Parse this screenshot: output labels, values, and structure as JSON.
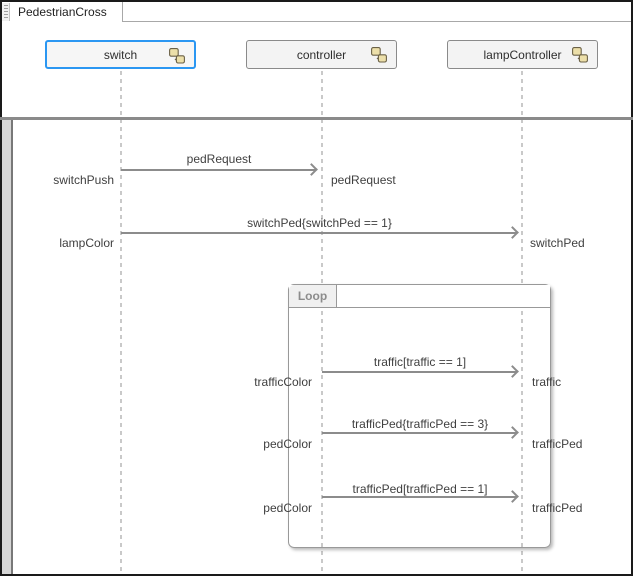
{
  "window": {
    "tab_title": "PedestrianCross"
  },
  "participants": [
    {
      "name": "switch",
      "selected": true
    },
    {
      "name": "controller",
      "selected": false
    },
    {
      "name": "lampController",
      "selected": false
    }
  ],
  "fragment": {
    "operator": "Loop"
  },
  "messages": [
    {
      "label": "pedRequest",
      "source_event": "switchPush",
      "target_event": "pedRequest",
      "from": "switch",
      "to": "controller"
    },
    {
      "label": "switchPed{switchPed == 1}",
      "source_event": "lampColor",
      "target_event": "switchPed",
      "from": "switch",
      "to": "lampController"
    },
    {
      "label": "traffic[traffic == 1]",
      "source_event": "trafficColor",
      "target_event": "traffic",
      "from": "controller",
      "to": "lampController"
    },
    {
      "label": "trafficPed{trafficPed == 3}",
      "source_event": "pedColor",
      "target_event": "trafficPed",
      "from": "controller",
      "to": "lampController"
    },
    {
      "label": "trafficPed[trafficPed == 1]",
      "source_event": "pedColor",
      "target_event": "trafficPed",
      "from": "controller",
      "to": "lampController"
    }
  ],
  "colors": {
    "selection_blue": "#2b97f2",
    "message_gray": "#8c8c8c",
    "lifeline_gray": "#c9c9c9",
    "fragment_border": "#999999",
    "icon_fill": "#ecdfa9",
    "icon_stroke": "#6b6146"
  }
}
